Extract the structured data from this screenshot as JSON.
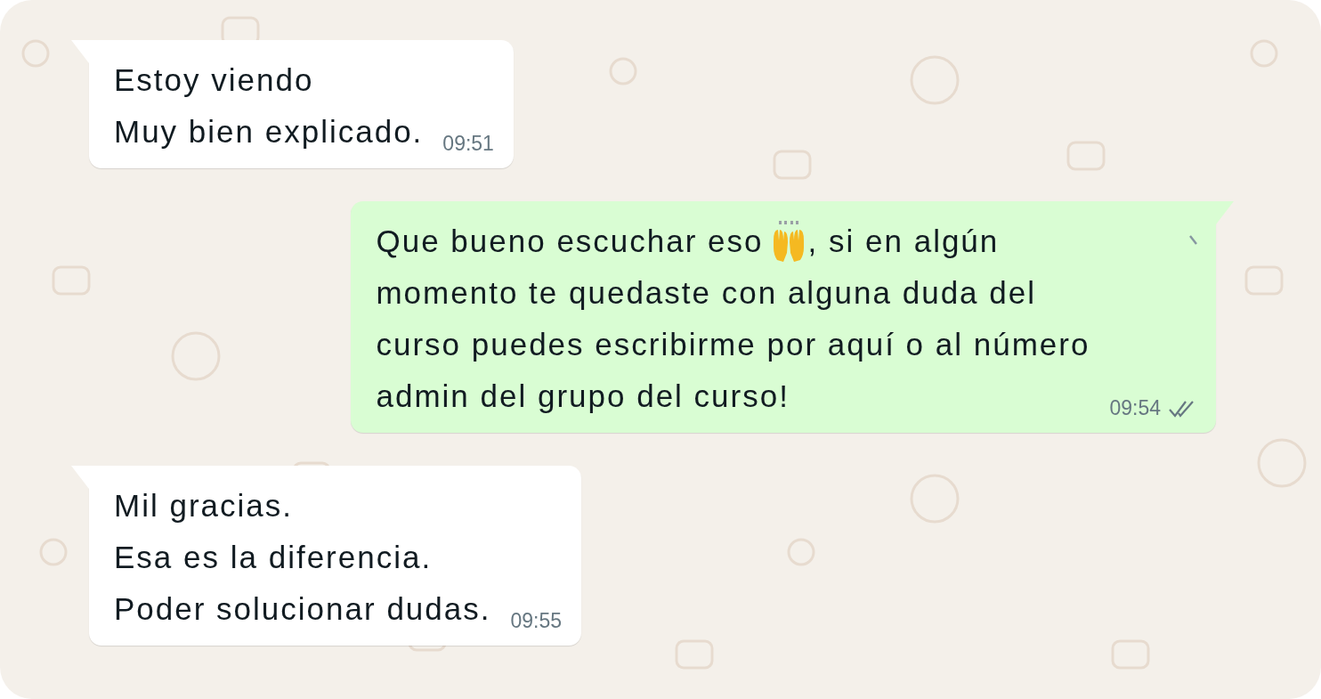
{
  "messages": [
    {
      "kind": "in",
      "lines": [
        [
          "Estoy viendo"
        ],
        [
          "Muy bien explicado."
        ]
      ],
      "time": "09:51"
    },
    {
      "kind": "out",
      "lines": [
        [
          "Que bueno escuchar eso",
          ", si en algún"
        ],
        [
          "momento te quedaste con alguna duda del"
        ],
        [
          "curso puedes escribirme por aquí o al número"
        ],
        [
          "admin del grupo del curso!"
        ]
      ],
      "time": "09:54",
      "delivered": true
    },
    {
      "kind": "in",
      "lines": [
        [
          "Mil gracias."
        ],
        [
          "Esa es la diferencia."
        ],
        [
          "Poder solucionar dudas."
        ]
      ],
      "time": "09:55"
    }
  ]
}
